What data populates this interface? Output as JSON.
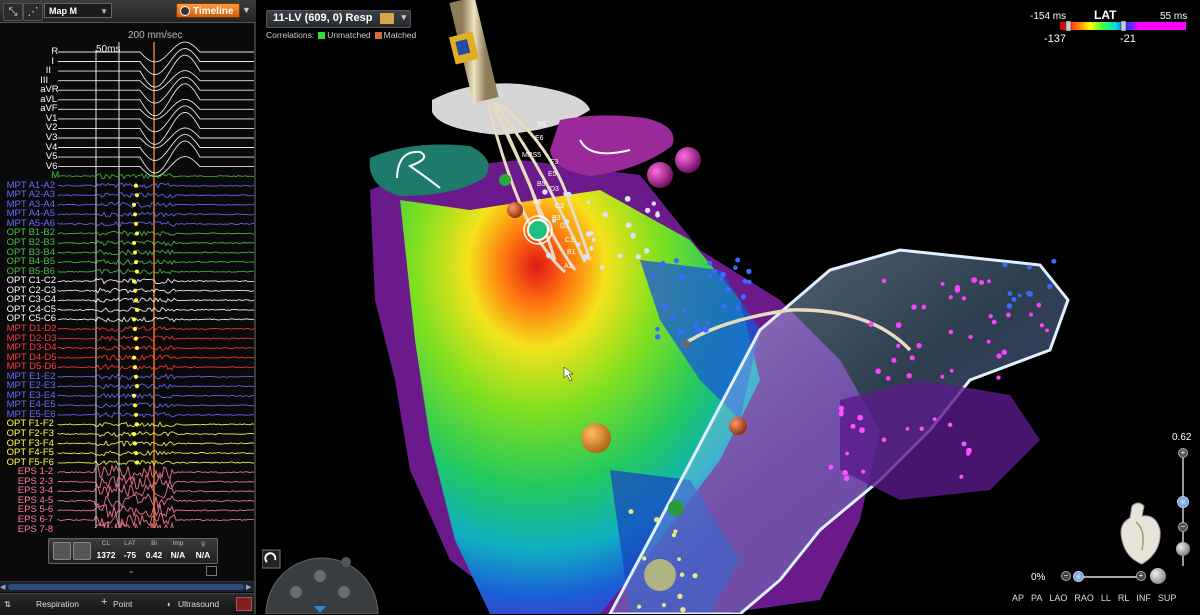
{
  "toolbar": {
    "map_select": "Map M",
    "timeline_label": "Timeline",
    "icons": [
      "cursor-tool-icon",
      "waveform-tool-icon"
    ]
  },
  "ecg": {
    "speed": "200 mm/sec",
    "scale_label": "50ms",
    "leads": [
      {
        "label": "R",
        "color": "#ffffff"
      },
      {
        "label": "I",
        "color": "#ffffff"
      },
      {
        "label": "II",
        "color": "#ffffff"
      },
      {
        "label": "III",
        "color": "#ffffff"
      },
      {
        "label": "aVR",
        "color": "#ffffff"
      },
      {
        "label": "aVL",
        "color": "#ffffff"
      },
      {
        "label": "aVF",
        "color": "#ffffff"
      },
      {
        "label": "V1",
        "color": "#ffffff"
      },
      {
        "label": "V2",
        "color": "#ffffff"
      },
      {
        "label": "V3",
        "color": "#ffffff"
      },
      {
        "label": "V4",
        "color": "#ffffff"
      },
      {
        "label": "V5",
        "color": "#ffffff"
      },
      {
        "label": "V6",
        "color": "#ffffff"
      },
      {
        "label": "M",
        "color": "#3fbf3f"
      },
      {
        "label": "MPT A1-A2",
        "color": "#6a6aff"
      },
      {
        "label": "MPT A2-A3",
        "color": "#6a6aff"
      },
      {
        "label": "MPT A3-A4",
        "color": "#6a6aff"
      },
      {
        "label": "MPT A4-A5",
        "color": "#6a6aff"
      },
      {
        "label": "MPT A5-A6",
        "color": "#6a6aff"
      },
      {
        "label": "OPT B1-B2",
        "color": "#4fbf4f"
      },
      {
        "label": "OPT B2-B3",
        "color": "#4fbf4f"
      },
      {
        "label": "OPT B3-B4",
        "color": "#4fbf4f"
      },
      {
        "label": "OPT B4-B5",
        "color": "#4fbf4f"
      },
      {
        "label": "OPT B5-B6",
        "color": "#4fbf4f"
      },
      {
        "label": "OPT C1-C2",
        "color": "#ffffff"
      },
      {
        "label": "OPT C2-C3",
        "color": "#ffffff"
      },
      {
        "label": "OPT C3-C4",
        "color": "#ffffff"
      },
      {
        "label": "OPT C4-C5",
        "color": "#ffffff"
      },
      {
        "label": "OPT C5-C6",
        "color": "#ffffff"
      },
      {
        "label": "MPT D1-D2",
        "color": "#ff3b3b"
      },
      {
        "label": "MPT D2-D3",
        "color": "#ff3b3b"
      },
      {
        "label": "MPT D3-D4",
        "color": "#ff3b3b"
      },
      {
        "label": "MPT D4-D5",
        "color": "#ff3b3b"
      },
      {
        "label": "MPT D5-D6",
        "color": "#ff3b3b"
      },
      {
        "label": "MPT E1-E2",
        "color": "#6a6aff"
      },
      {
        "label": "MPT E2-E3",
        "color": "#6a6aff"
      },
      {
        "label": "MPT E3-E4",
        "color": "#6a6aff"
      },
      {
        "label": "MPT E4-E5",
        "color": "#6a6aff"
      },
      {
        "label": "MPT E5-E6",
        "color": "#6a6aff"
      },
      {
        "label": "OPT F1-F2",
        "color": "#ffff55"
      },
      {
        "label": "OPT F2-F3",
        "color": "#ffff55"
      },
      {
        "label": "OPT F3-F4",
        "color": "#ffff55"
      },
      {
        "label": "OPT F4-F5",
        "color": "#ffff55"
      },
      {
        "label": "OPT F5-F6",
        "color": "#ffff55"
      },
      {
        "label": "EPS 1-2",
        "color": "#ff7f9f"
      },
      {
        "label": "EPS 2-3",
        "color": "#ff7f9f"
      },
      {
        "label": "EPS 3-4",
        "color": "#ff7f9f"
      },
      {
        "label": "EPS 4-5",
        "color": "#ff7f9f"
      },
      {
        "label": "EPS 5-6",
        "color": "#ff7f9f"
      },
      {
        "label": "EPS 6-7",
        "color": "#ff7f9f"
      },
      {
        "label": "EPS 7-8",
        "color": "#ff7f9f"
      }
    ]
  },
  "readout": {
    "columns": [
      {
        "label": "CL",
        "value": "1372"
      },
      {
        "label": "LAT",
        "value": "-75"
      },
      {
        "label": "Bi",
        "value": "0.42"
      },
      {
        "label": "Imp",
        "value": "N/A"
      },
      {
        "label": "g",
        "value": "N/A"
      }
    ]
  },
  "bottom_bar": {
    "respiration": "Respiration",
    "point": "Point",
    "ultrasound": "Ultrasound"
  },
  "view": {
    "title": "11-LV (609, 0) Resp",
    "correlations_label": "Correlations:",
    "unmatched_label": "Unmatched",
    "matched_label": "Matched",
    "unmatched_color": "#33dd33",
    "matched_color": "#d2703a"
  },
  "lat": {
    "title": "LAT",
    "min": "-154 ms",
    "max": "55 ms",
    "low_marker": "-137",
    "high_marker": "-21"
  },
  "zoom": {
    "value": "0.62"
  },
  "opacity": {
    "value": "0%"
  },
  "view_buttons": [
    "AP",
    "PA",
    "LAO",
    "RAO",
    "LL",
    "RL",
    "INF",
    "SUP"
  ],
  "colors": {
    "accent_orange": "#e87a1e",
    "panel_bg": "#0a0a0a"
  }
}
